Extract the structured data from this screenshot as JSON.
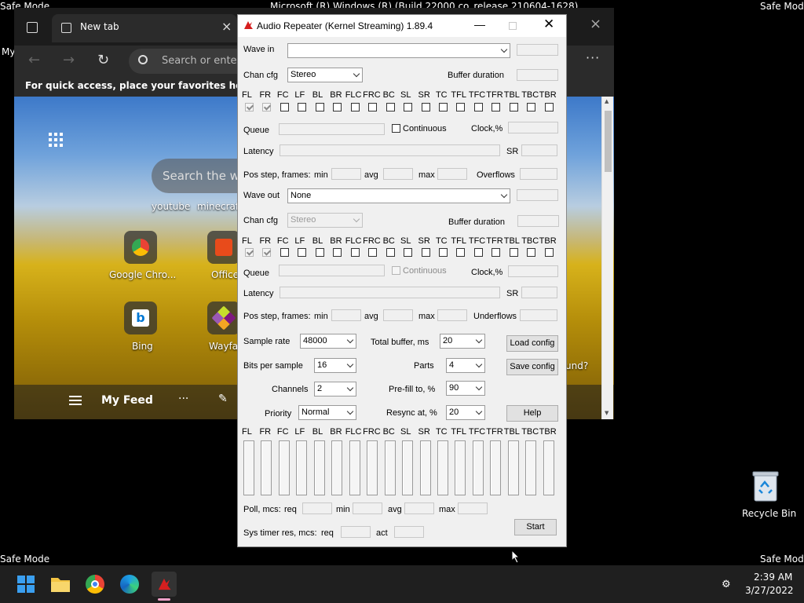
{
  "desktop": {
    "safe_mode": "Safe Mode",
    "build_text": "Microsoft (R) Windows (R) (Build 22000.co_release.210604-1628)",
    "recycle_bin": "Recycle Bin"
  },
  "edge": {
    "tab_title": "New tab",
    "address_placeholder": "Search or enter",
    "favorites_hint": "For quick access, place your favorites here on the",
    "search_placeholder": "Search the we",
    "quick_links": [
      "youtube",
      "minecraft"
    ],
    "speed_dials": [
      "Google Chro...",
      "Office",
      "Bing",
      "Wayfai"
    ],
    "my_feed": "My Feed",
    "left_fragment": "My",
    "right_fragment": "und?"
  },
  "dialog": {
    "title": "Audio Repeater (Kernel Streaming) 1.89.4",
    "wave_in_label": "Wave in",
    "wave_in_value": "",
    "wave_out_label": "Wave out",
    "wave_out_value": "None",
    "chan_cfg_label": "Chan cfg",
    "chan_in_value": "Stereo",
    "chan_out_value": "Stereo",
    "buffer_duration": "Buffer duration",
    "channels": [
      "FL",
      "FR",
      "FC",
      "LF",
      "BL",
      "BR",
      "FLC",
      "FRC",
      "BC",
      "SL",
      "SR",
      "TC",
      "TFL",
      "TFC",
      "TFR",
      "TBL",
      "TBC",
      "TBR"
    ],
    "queue": "Queue",
    "continuous": "Continuous",
    "clock": "Clock,%",
    "latency": "Latency",
    "sr": "SR",
    "pos_step": "Pos step, frames:",
    "min": "min",
    "avg": "avg",
    "max": "max",
    "overflows": "Overflows",
    "underflows": "Underflows",
    "sample_rate_label": "Sample rate",
    "sample_rate": "48000",
    "total_buffer_label": "Total buffer, ms",
    "total_buffer": "20",
    "load_config": "Load config",
    "bits_label": "Bits per sample",
    "bits": "16",
    "parts_label": "Parts",
    "parts": "4",
    "save_config": "Save config",
    "channels_label": "Channels",
    "channels_value": "2",
    "prefill_label": "Pre-fill to, %",
    "prefill": "90",
    "priority_label": "Priority",
    "priority": "Normal",
    "resync_label": "Resync at, %",
    "resync": "20",
    "help": "Help",
    "poll": "Poll, mcs:",
    "req": "req",
    "sys_timer": "Sys timer res, mcs:",
    "act": "act",
    "start": "Start"
  },
  "taskbar": {
    "time": "2:39 AM",
    "date": "3/27/2022"
  },
  "colors": {
    "accent": "#0078d4",
    "dialog_bg": "#f0f0f0",
    "taskbar_bg": "#1f1f1f"
  }
}
